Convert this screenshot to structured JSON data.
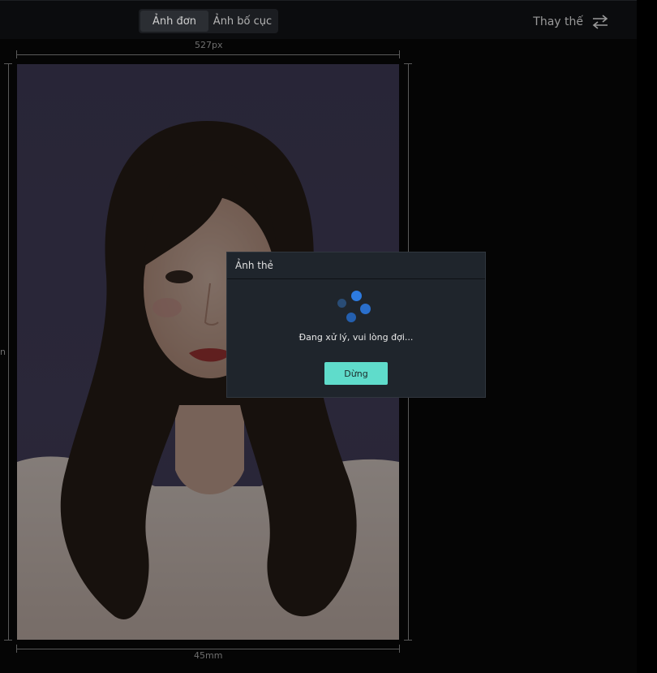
{
  "tabs": [
    {
      "label": "Ảnh đơn",
      "active": true
    },
    {
      "label": "Ảnh bố cục",
      "active": false
    }
  ],
  "replace": {
    "label": "Thay thế",
    "icon": "swap-arrows-icon"
  },
  "dimensions": {
    "width_px": "527px",
    "width_mm": "45mm",
    "height_label_partial": "n"
  },
  "dialog": {
    "title": "Ảnh thẻ",
    "message": "Đang xử lý, vui lòng đợi...",
    "stop_label": "Dừng"
  },
  "colors": {
    "accent": "#5fdccb",
    "spinner": "#2d7be0",
    "photo_background": "#4a4464"
  }
}
